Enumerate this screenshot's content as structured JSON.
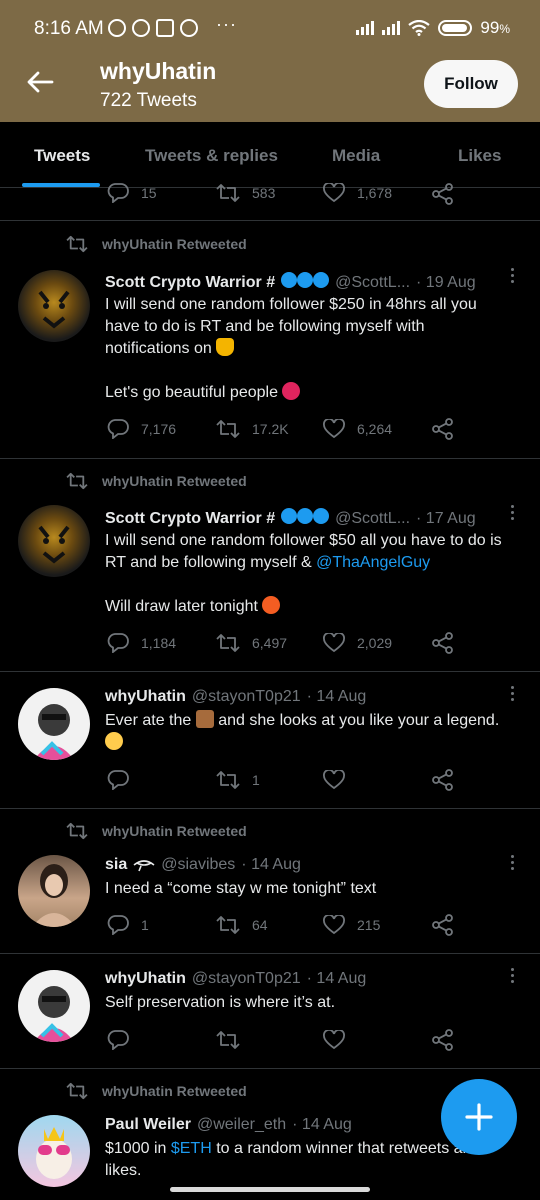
{
  "status_bar": {
    "time": "8:16 AM",
    "battery": "99",
    "battery_unit": "%",
    "dots": "···"
  },
  "header": {
    "name": "whyUhatin",
    "tweet_count": "722 Tweets",
    "follow_label": "Follow"
  },
  "tabs": [
    {
      "label": "Tweets",
      "active": true
    },
    {
      "label": "Tweets & replies",
      "active": false
    },
    {
      "label": "Media",
      "active": false
    },
    {
      "label": "Likes",
      "active": false
    }
  ],
  "partial_tweet": {
    "replies": "15",
    "retweets": "583",
    "likes": "1,678"
  },
  "tweets": [
    {
      "retweeted_by": "whyUhatin Retweeted",
      "name": "Scott Crypto Warrior #",
      "handle": "@ScottL...",
      "date": "· 19 Aug",
      "line1": "I will send one random follower $250 in 48hrs all you",
      "line2": "have to do is RT and be following myself with",
      "line3": "notifications on",
      "line4": "Let's go beautiful people",
      "replies": "7,176",
      "retweets": "17.2K",
      "likes": "6,264"
    },
    {
      "retweeted_by": "whyUhatin Retweeted",
      "name": "Scott Crypto Warrior #",
      "handle": "@ScottL...",
      "date": "· 17 Aug",
      "line1": "I will send one random follower $50 all you have to do is",
      "line2": "RT and be following myself &",
      "mention": "@ThaAngelGuy",
      "line3": "Will draw later tonight",
      "replies": "1,184",
      "retweets": "6,497",
      "likes": "2,029"
    },
    {
      "name": "whyUhatin",
      "handle": "@stayonT0p21",
      "date": "· 14 Aug",
      "line1a": "Ever ate the",
      "line1b": "and she looks at you like your a legend.",
      "retweets": "1"
    },
    {
      "retweeted_by": "whyUhatin Retweeted",
      "name": "sia",
      "handle": "@siavibes",
      "date": "· 14 Aug",
      "line1": "I need a “come stay w me tonight” text",
      "replies": "1",
      "retweets": "64",
      "likes": "215"
    },
    {
      "name": "whyUhatin",
      "handle": "@stayonT0p21",
      "date": "· 14 Aug",
      "line1": "Self preservation is where it’s at."
    },
    {
      "retweeted_by": "whyUhatin Retweeted",
      "name": "Paul Weiler",
      "handle": "@weiler_eth",
      "date": "· 14 Aug",
      "line1a": "$1000 in",
      "cashtag": "$ETH",
      "line1b": "to a random winner that retweets and",
      "line2": "likes."
    }
  ],
  "colors": {
    "header_bg": "#7d6a46",
    "accent": "#1d9bf0",
    "text": "#e7e9ea",
    "muted": "#71767b"
  }
}
